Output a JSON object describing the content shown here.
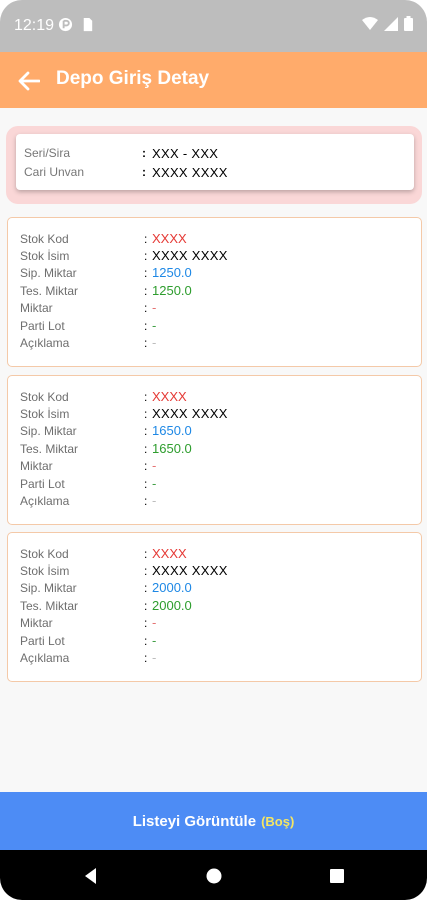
{
  "status": {
    "time": "12:19"
  },
  "header": {
    "title": "Depo Giriş Detay"
  },
  "summary": {
    "rows": [
      {
        "label": "Seri/Sira",
        "value": "XXX - XXX"
      },
      {
        "label": "Cari Unvan",
        "value": "XXXX XXXX"
      }
    ]
  },
  "items": [
    {
      "stok_kod_label": "Stok Kod",
      "stok_kod": "XXXX",
      "stok_isim_label": "Stok İsim",
      "stok_isim": "XXXX XXXX",
      "sip_label": "Sip. Miktar",
      "sip": "1250.0",
      "tes_label": "Tes. Miktar",
      "tes": "1250.0",
      "miktar_label": "Miktar",
      "miktar": "-",
      "parti_label": "Parti Lot",
      "parti": "-",
      "aciklama_label": "Açıklama",
      "aciklama": "-"
    },
    {
      "stok_kod_label": "Stok Kod",
      "stok_kod": "XXXX",
      "stok_isim_label": "Stok İsim",
      "stok_isim": "XXXX XXXX",
      "sip_label": "Sip. Miktar",
      "sip": "1650.0",
      "tes_label": "Tes. Miktar",
      "tes": "1650.0",
      "miktar_label": "Miktar",
      "miktar": "-",
      "parti_label": "Parti Lot",
      "parti": "-",
      "aciklama_label": "Açıklama",
      "aciklama": "-"
    },
    {
      "stok_kod_label": "Stok Kod",
      "stok_kod": "XXXX",
      "stok_isim_label": "Stok İsim",
      "stok_isim": "XXXX XXXX",
      "sip_label": "Sip. Miktar",
      "sip": "2000.0",
      "tes_label": "Tes. Miktar",
      "tes": "2000.0",
      "miktar_label": "Miktar",
      "miktar": "-",
      "parti_label": "Parti Lot",
      "parti": "-",
      "aciklama_label": "Açıklama",
      "aciklama": "-"
    }
  ],
  "colon": ":",
  "footer": {
    "button_label": "Listeyi Görüntüle",
    "button_status": "(Boş)"
  },
  "colors": {
    "app_bar": "#ffab6b",
    "button": "#4d8cf5",
    "code": "#e53935",
    "ordered": "#1e88e5",
    "delivered": "#2e9d2e"
  },
  "icons": {
    "back": "arrow-left-icon",
    "nav_back": "triangle-back-icon",
    "nav_home": "circle-home-icon",
    "nav_recent": "square-recent-icon"
  }
}
